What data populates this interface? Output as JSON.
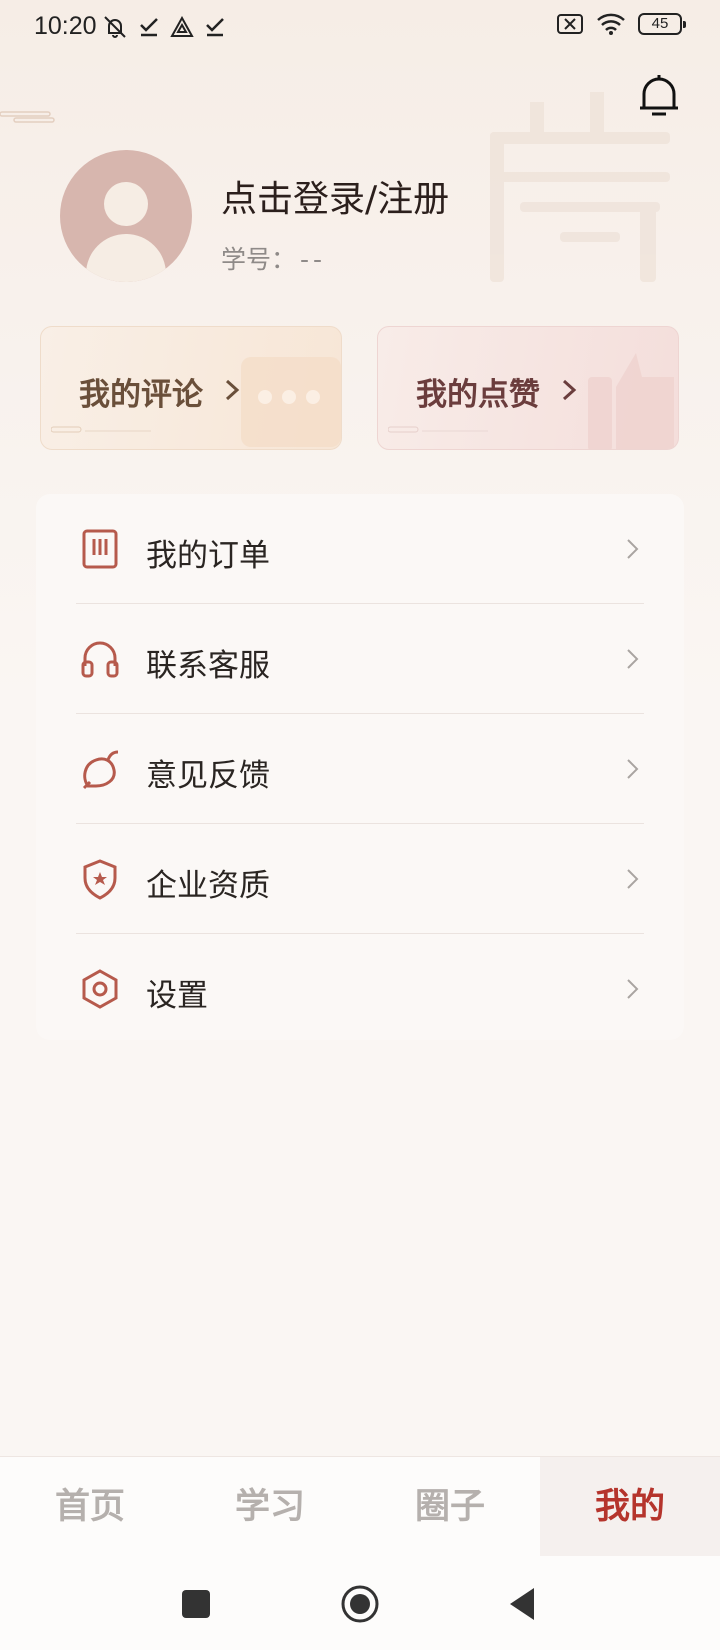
{
  "status_bar": {
    "time": "10:20",
    "battery": "45"
  },
  "profile": {
    "login_prompt": "点击登录/注册",
    "student_no_label": "学号：",
    "student_no_value": "--"
  },
  "cards": {
    "comments": "我的评论",
    "likes": "我的点赞"
  },
  "menu": {
    "items": [
      {
        "label": "我的订单",
        "icon": "order-icon"
      },
      {
        "label": "联系客服",
        "icon": "headset-icon"
      },
      {
        "label": "意见反馈",
        "icon": "feedback-icon"
      },
      {
        "label": "企业资质",
        "icon": "shield-star-icon"
      },
      {
        "label": "设置",
        "icon": "settings-hexagon-icon"
      }
    ]
  },
  "tabbar": {
    "tabs": [
      {
        "label": "首页"
      },
      {
        "label": "学习"
      },
      {
        "label": "圈子"
      },
      {
        "label": "我的",
        "active": true
      }
    ]
  },
  "colors": {
    "accent": "#b5342c",
    "icon": "#b65a4c",
    "inactive_tab": "#b5b0ad"
  }
}
